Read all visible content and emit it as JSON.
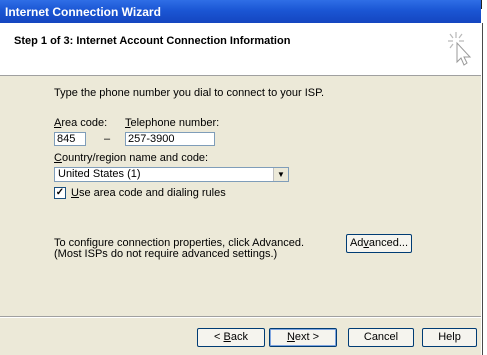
{
  "window": {
    "title": "Internet Connection Wizard"
  },
  "header": {
    "step_title": "Step 1 of 3: Internet Account Connection Information"
  },
  "content": {
    "instruction": "Type the phone number you dial to connect to your ISP.",
    "area_code": {
      "label_mnemonic": "A",
      "label_rest": "rea code:",
      "value": "845"
    },
    "dash": "–",
    "telephone": {
      "label_mnemonic": "T",
      "label_rest": "elephone number:",
      "value": "257-3900"
    },
    "country": {
      "label_mnemonic": "C",
      "label_rest": "ountry/region name and code:",
      "value": "United States (1)"
    },
    "use_rules": {
      "checked": true,
      "label_mnemonic": "U",
      "label_rest": "se area code and dialing rules"
    },
    "advanced_note_line1": "To configure connection properties, click Advanced.",
    "advanced_note_line2": "(Most ISPs do not require advanced settings.)",
    "advanced_button": {
      "pre": "Ad",
      "mnemonic": "v",
      "post": "anced..."
    }
  },
  "footer": {
    "back": {
      "prefix": "< ",
      "mnemonic": "B",
      "rest": "ack"
    },
    "next": {
      "mnemonic": "N",
      "rest": "ext >"
    },
    "cancel": "Cancel",
    "help": "Help"
  }
}
